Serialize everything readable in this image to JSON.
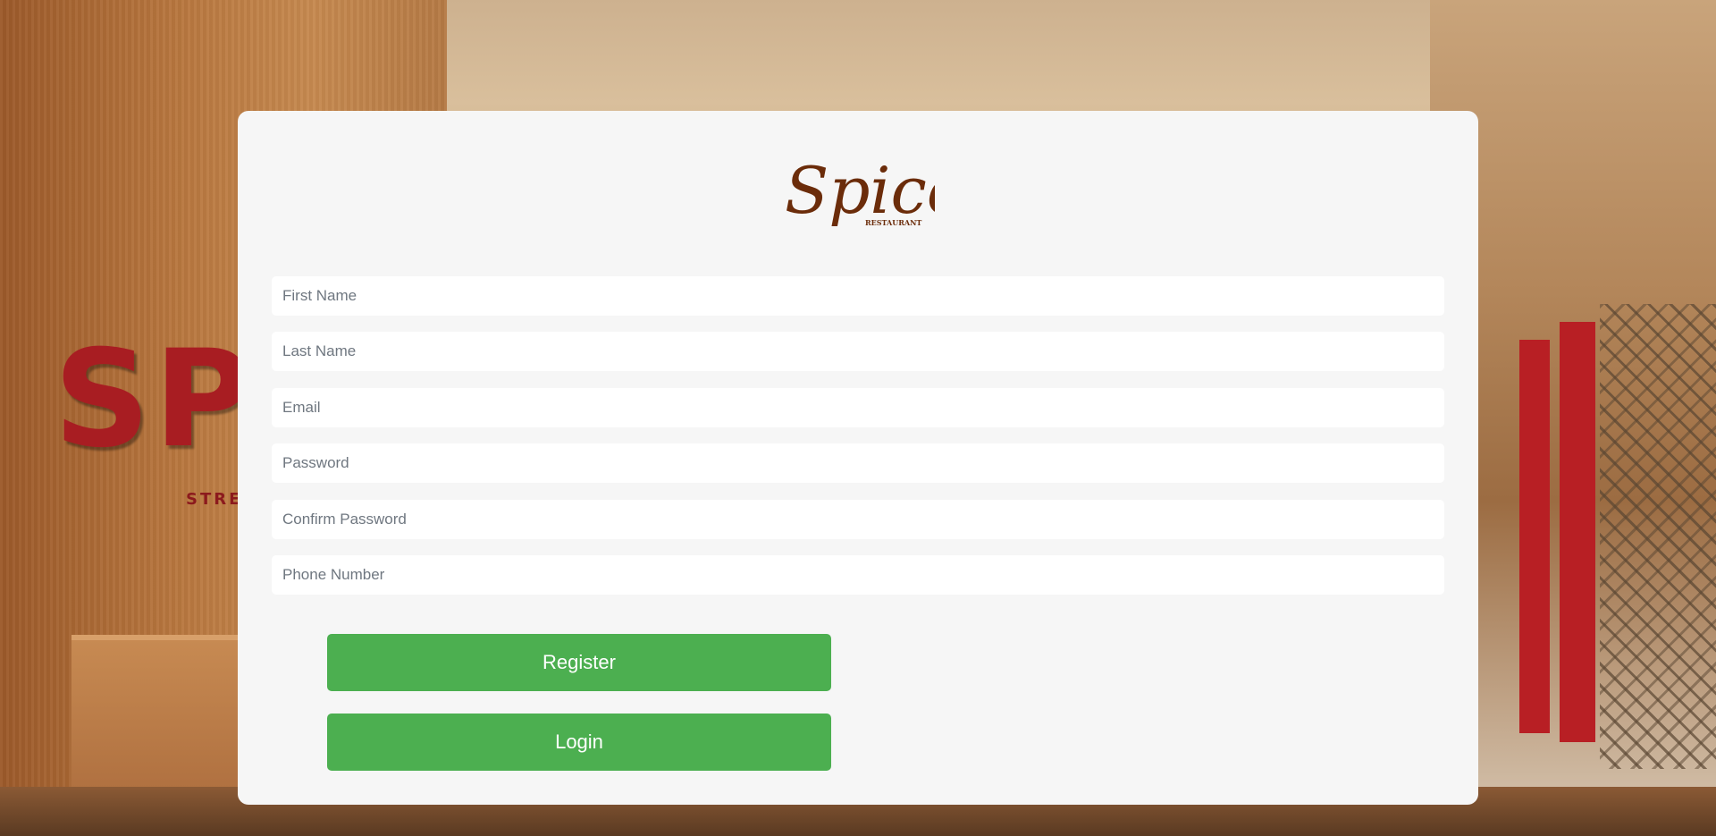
{
  "brand": {
    "logo_text": "Spice",
    "logo_subtext": "RESTAURANT",
    "color": "#6b2c0a"
  },
  "background": {
    "sign_text": "SPI",
    "sign_subtext": "STRE"
  },
  "form": {
    "first_name_placeholder": "First Name",
    "last_name_placeholder": "Last Name",
    "email_placeholder": "Email",
    "password_placeholder": "Password",
    "confirm_password_placeholder": "Confirm Password",
    "phone_placeholder": "Phone Number"
  },
  "buttons": {
    "register_label": "Register",
    "login_label": "Login",
    "color": "#4caf50"
  }
}
